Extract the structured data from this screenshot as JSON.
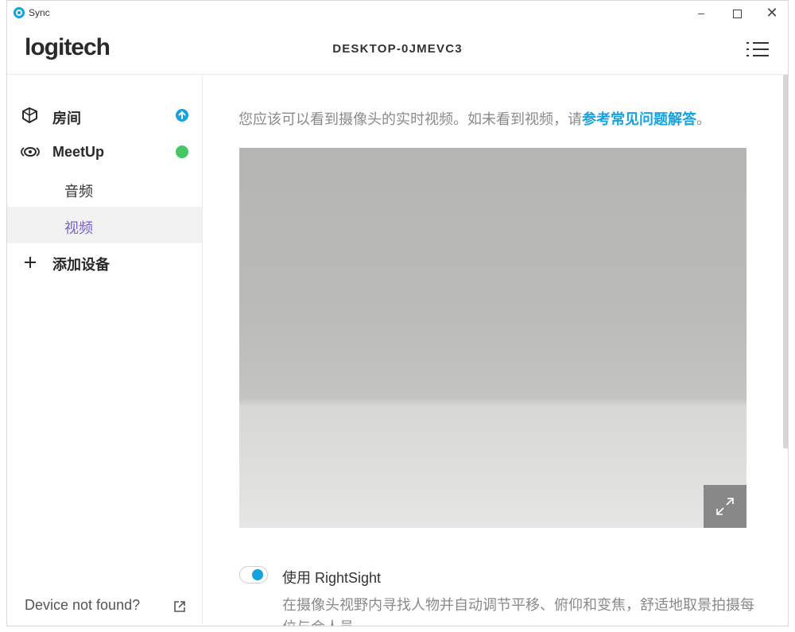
{
  "window": {
    "app_title": "Sync",
    "controls": {
      "minimize": "–",
      "close": "✕"
    }
  },
  "header": {
    "logo": "logitech",
    "device_name": "DESKTOP-0JMEVC3"
  },
  "sidebar": {
    "items": [
      {
        "label": "房间",
        "icon": "room-icon",
        "badge": "update-badge",
        "badge_color": "#14a3e0"
      },
      {
        "label": "MeetUp",
        "icon": "camera-device-icon",
        "badge": "status-dot",
        "badge_color": "#45c765"
      }
    ],
    "sub_items": [
      {
        "label": "音频",
        "active": false
      },
      {
        "label": "视频",
        "active": true
      }
    ],
    "add_device": {
      "label": "添加设备",
      "icon": "plus-icon"
    },
    "footer": {
      "label": "Device not found?",
      "icon": "external-link-icon"
    }
  },
  "main": {
    "info_text": "您应该可以看到摄像头的实时视频。如未看到视频，请",
    "info_link": "参考常见问题解答",
    "info_end": "。",
    "video": {
      "expand_icon": "expand-icon"
    },
    "rightsight": {
      "enabled": true,
      "label": "使用 RightSight",
      "description": "在摄像头视野内寻找人物并自动调节平移、俯仰和变焦，舒适地取景拍摄每位与会人员"
    }
  },
  "colors": {
    "accent": "#14a3e0",
    "active_nav": "#7a5fd6",
    "status_green": "#45c765"
  }
}
